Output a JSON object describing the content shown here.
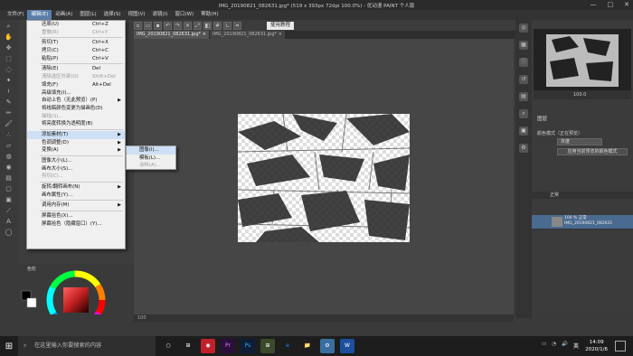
{
  "window": {
    "title": "IMG_20190821_082631.jpg* (519 x 393px 72dpi 100.0%)  - 优动漫 PAINT 个人版",
    "controls": [
      "—",
      "□",
      "✕"
    ]
  },
  "menubar": [
    "文件(F)",
    "编辑(E)",
    "动画(A)",
    "图层(L)",
    "选择(S)",
    "视图(V)",
    "滤镜(I)",
    "窗口(W)",
    "帮助(H)"
  ],
  "toolbar": {
    "tutorial_label": "使用教程"
  },
  "tabs": [
    {
      "label": "IMG_20190821_082631.jpg*"
    },
    {
      "label": "IMG_20190821_082631.jpg*"
    }
  ],
  "edit_menu": {
    "items": [
      {
        "label": "还原(U)",
        "shortcut": "Ctrl+Z",
        "disabled": false
      },
      {
        "label": "重做(R)",
        "shortcut": "Ctrl+Y",
        "disabled": true
      },
      {
        "sep": true
      },
      {
        "label": "剪切(T)",
        "shortcut": "Ctrl+X",
        "disabled": false
      },
      {
        "label": "拷贝(C)",
        "shortcut": "Ctrl+C",
        "disabled": false
      },
      {
        "label": "粘贴(P)",
        "shortcut": "Ctrl+V",
        "disabled": false
      },
      {
        "sep": true
      },
      {
        "label": "清除(E)",
        "shortcut": "Del",
        "disabled": false
      },
      {
        "label": "清除选区外部(O)",
        "shortcut": "Shift+Del",
        "disabled": true
      },
      {
        "label": "填充(F)",
        "shortcut": "Alt+Del",
        "disabled": false
      },
      {
        "label": "高级填充(I)...",
        "shortcut": "",
        "disabled": false
      },
      {
        "label": "自动上色（无此预览）(P)",
        "shortcut": "",
        "disabled": false,
        "submenu": true
      },
      {
        "label": "将线稿颜色变更为描画色(D)",
        "shortcut": "",
        "disabled": false
      },
      {
        "label": "描线(S)...",
        "shortcut": "",
        "disabled": true
      },
      {
        "label": "将亮度转换为透明度(B)",
        "shortcut": "",
        "disabled": false
      },
      {
        "sep": true
      },
      {
        "label": "添加素材(T)",
        "shortcut": "",
        "disabled": false,
        "submenu": true,
        "highlight": true
      },
      {
        "label": "色调调整(D)",
        "shortcut": "",
        "disabled": false,
        "submenu": true
      },
      {
        "label": "变换(A)",
        "shortcut": "",
        "disabled": false,
        "submenu": true
      },
      {
        "sep": true
      },
      {
        "label": "图像大小(L)...",
        "shortcut": "",
        "disabled": false
      },
      {
        "label": "画布大小(S)...",
        "shortcut": "",
        "disabled": false
      },
      {
        "label": "剪切(C)...",
        "shortcut": "",
        "disabled": true
      },
      {
        "sep": true
      },
      {
        "label": "旋转/翻转画布(N)",
        "shortcut": "",
        "disabled": false,
        "submenu": true
      },
      {
        "label": "画布属性(Y)...",
        "shortcut": "",
        "disabled": false
      },
      {
        "sep": true
      },
      {
        "label": "调用内存(M)",
        "shortcut": "",
        "disabled": false,
        "submenu": true
      },
      {
        "sep": true
      },
      {
        "label": "屏幕拾色(X)...",
        "shortcut": "",
        "disabled": false
      },
      {
        "label": "屏幕拾色（隐藏窗口）(Y)...",
        "shortcut": "",
        "disabled": false
      }
    ]
  },
  "add_material_submenu": [
    {
      "label": "图像(I)...",
      "disabled": false
    },
    {
      "label": "模板(L)...",
      "disabled": false
    },
    {
      "label": "涂料(A)...",
      "disabled": true
    }
  ],
  "navigator": {
    "zoom": "100.0"
  },
  "layer_property": {
    "title": "图层",
    "blend_label": "颜色模式（正在预览）",
    "blend_value": "灰度",
    "preview_button": "应用当前预览的颜色模式"
  },
  "layers": {
    "header": "正常",
    "rows": [
      {
        "name": "100 % 正常\nIMG_20190821_082631",
        "selected": true
      }
    ]
  },
  "color_panel": {
    "tab": "色轮"
  },
  "status": {
    "zoom": "100"
  },
  "taskbar": {
    "search_placeholder": "在这里输入你要搜索的内容",
    "apps": [
      "○",
      "⊞",
      "◉",
      "Pr",
      "Ps",
      "⊞",
      "e",
      "📁",
      "⚙",
      "W"
    ],
    "lang": "英",
    "time": "14:09",
    "date": "2020/1/6"
  },
  "colors": {
    "accent": "#5a7ea8",
    "menu_bg": "#f0f0f0",
    "highlight": "#cde0f5"
  }
}
